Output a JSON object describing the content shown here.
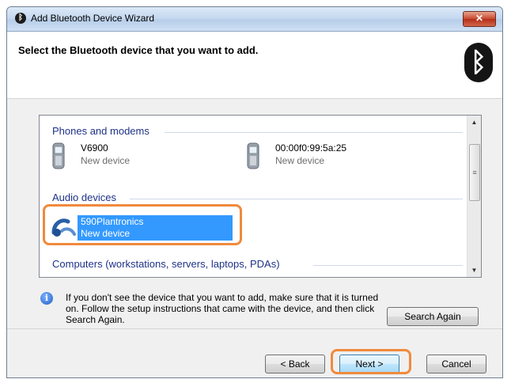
{
  "window": {
    "title": "Add Bluetooth Device Wizard",
    "close_glyph": "✕"
  },
  "header": {
    "instruction": "Select the Bluetooth device that you want to add."
  },
  "groups": [
    {
      "label": "Phones and modems"
    },
    {
      "label": "Audio devices"
    },
    {
      "label": "Computers (workstations, servers, laptops, PDAs)"
    }
  ],
  "devices": [
    {
      "name": "V6900",
      "status": "New device",
      "icon": "phone-icon"
    },
    {
      "name": "00:00f0:99:5a:25",
      "status": "New device",
      "icon": "phone-icon"
    },
    {
      "name": "590Plantronics",
      "status": "New device",
      "icon": "headset-icon",
      "selected": true
    }
  ],
  "info": {
    "text": "If you don't see the device that you want to add, make sure that it is turned on. Follow the setup instructions that came with the device, and then click Search Again."
  },
  "buttons": {
    "search_again": "Search Again",
    "back": "< Back",
    "next": "Next >",
    "cancel": "Cancel"
  },
  "colors": {
    "selection": "#3399ff",
    "highlight": "#f08a3c",
    "group_text": "#1e3287"
  }
}
